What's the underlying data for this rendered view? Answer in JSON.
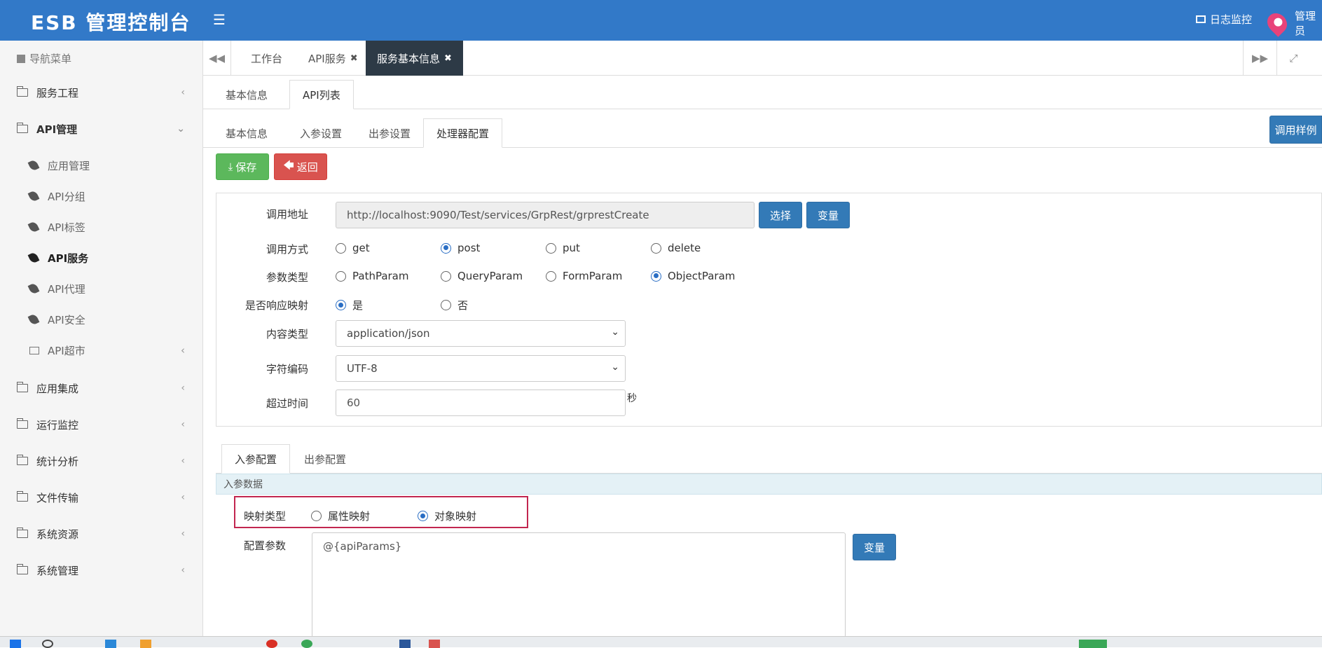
{
  "header": {
    "brand": "ESB 管理控制台",
    "menu_icon": "hamburger-icon",
    "log_monitor": "日志监控",
    "user": "管理员"
  },
  "sidebar": {
    "heading": "导航菜单",
    "items": [
      {
        "label": "服务工程"
      },
      {
        "label": "API管理"
      },
      {
        "label": "应用集成"
      },
      {
        "label": "运行监控"
      },
      {
        "label": "统计分析"
      },
      {
        "label": "文件传输"
      },
      {
        "label": "系统资源"
      },
      {
        "label": "系统管理"
      }
    ],
    "api_sub": [
      {
        "label": "应用管理"
      },
      {
        "label": "API分组"
      },
      {
        "label": "API标签"
      },
      {
        "label": "API服务"
      },
      {
        "label": "API代理"
      },
      {
        "label": "API安全"
      },
      {
        "label": "API超市"
      }
    ]
  },
  "tabs": [
    {
      "label": "工作台"
    },
    {
      "label": "API服务"
    },
    {
      "label": "服务基本信息"
    }
  ],
  "level1_tabs": [
    "基本信息",
    "API列表"
  ],
  "level2_tabs": [
    "基本信息",
    "入参设置",
    "出参设置",
    "处理器配置"
  ],
  "buttons": {
    "save": "保存",
    "back": "返回",
    "call_sample": "调用样例",
    "choose": "选择",
    "variable": "变量",
    "variable2": "变量"
  },
  "form": {
    "url_label": "调用地址",
    "url_value": "http://localhost:9090/Test/services/GrpRest/grprestCreate",
    "method_label": "调用方式",
    "methods": [
      "get",
      "post",
      "put",
      "delete"
    ],
    "method_selected": "post",
    "param_type_label": "参数类型",
    "param_types": [
      "PathParam",
      "QueryParam",
      "FormParam",
      "ObjectParam"
    ],
    "param_type_selected": "ObjectParam",
    "response_map_label": "是否响应映射",
    "response_map_options": [
      "是",
      "否"
    ],
    "response_map_selected": "是",
    "content_type_label": "内容类型",
    "content_type_value": "application/json",
    "charset_label": "字符编码",
    "charset_value": "UTF-8",
    "timeout_label": "超过时间",
    "timeout_value": "60",
    "timeout_unit": "秒"
  },
  "param_tabs": [
    "入参配置",
    "出参配置"
  ],
  "param_section": {
    "title": "入参数据",
    "map_type_label": "映射类型",
    "map_options": [
      "属性映射",
      "对象映射"
    ],
    "map_selected": "对象映射",
    "config_label": "配置参数",
    "config_value": "@{apiParams}"
  },
  "colors": {
    "header_bg": "#3279c8",
    "active_tab_bg": "#2d3a46",
    "highlight_border": "#c2264f"
  }
}
